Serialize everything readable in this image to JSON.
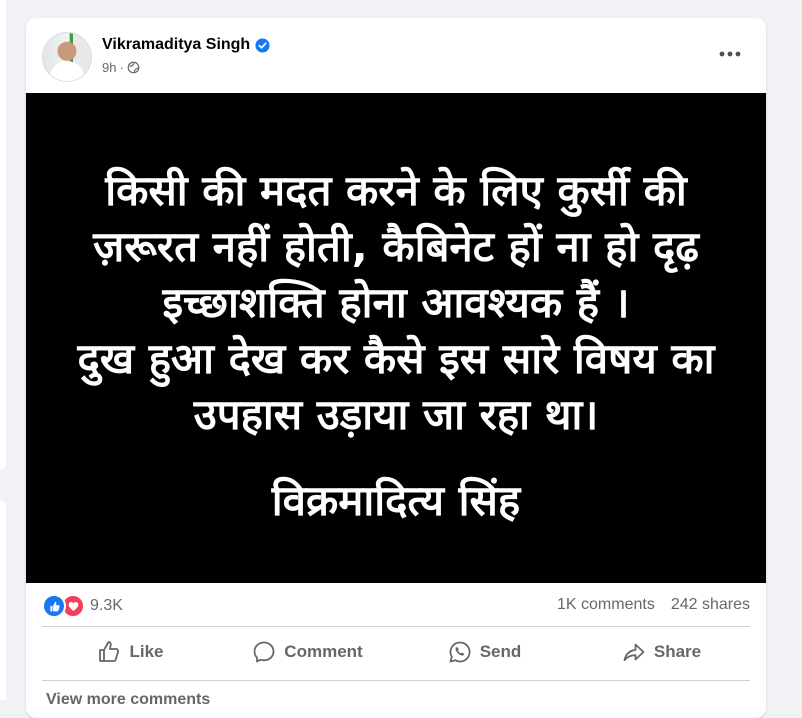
{
  "post": {
    "author": "Vikramaditya Singh",
    "time": "9h",
    "image_text": {
      "lines": [
        "किसी की मदत करने के लिए कुर्सी की",
        "ज़रूरत नहीं होती, कैबिनेट हों ना हो दृढ़",
        "इच्छाशक्ति होना आवश्यक हैं ।",
        "दुख हुआ देख कर कैसे इस सारे विषय का",
        "उपहास उड़ाया जा रहा था।"
      ],
      "signature": "विक्रमादित्य सिंह"
    },
    "reaction_count": "9.3K",
    "comments": "1K comments",
    "shares": "242 shares"
  },
  "actions": {
    "like": "Like",
    "comment": "Comment",
    "send": "Send",
    "share": "Share"
  },
  "view_more": "View more comments",
  "colors": {
    "background": "#f0f2f5",
    "card": "#ffffff",
    "secondary_text": "#65676b",
    "like_blue": "#1877f2",
    "love_red": "#f33e58",
    "image_background": "#000000"
  },
  "icons": [
    "verified-badge-icon",
    "globe-icon",
    "more-options-icon",
    "like-reaction-icon",
    "love-reaction-icon",
    "thumbs-up-icon",
    "comment-bubble-icon",
    "whatsapp-icon",
    "share-arrow-icon"
  ]
}
